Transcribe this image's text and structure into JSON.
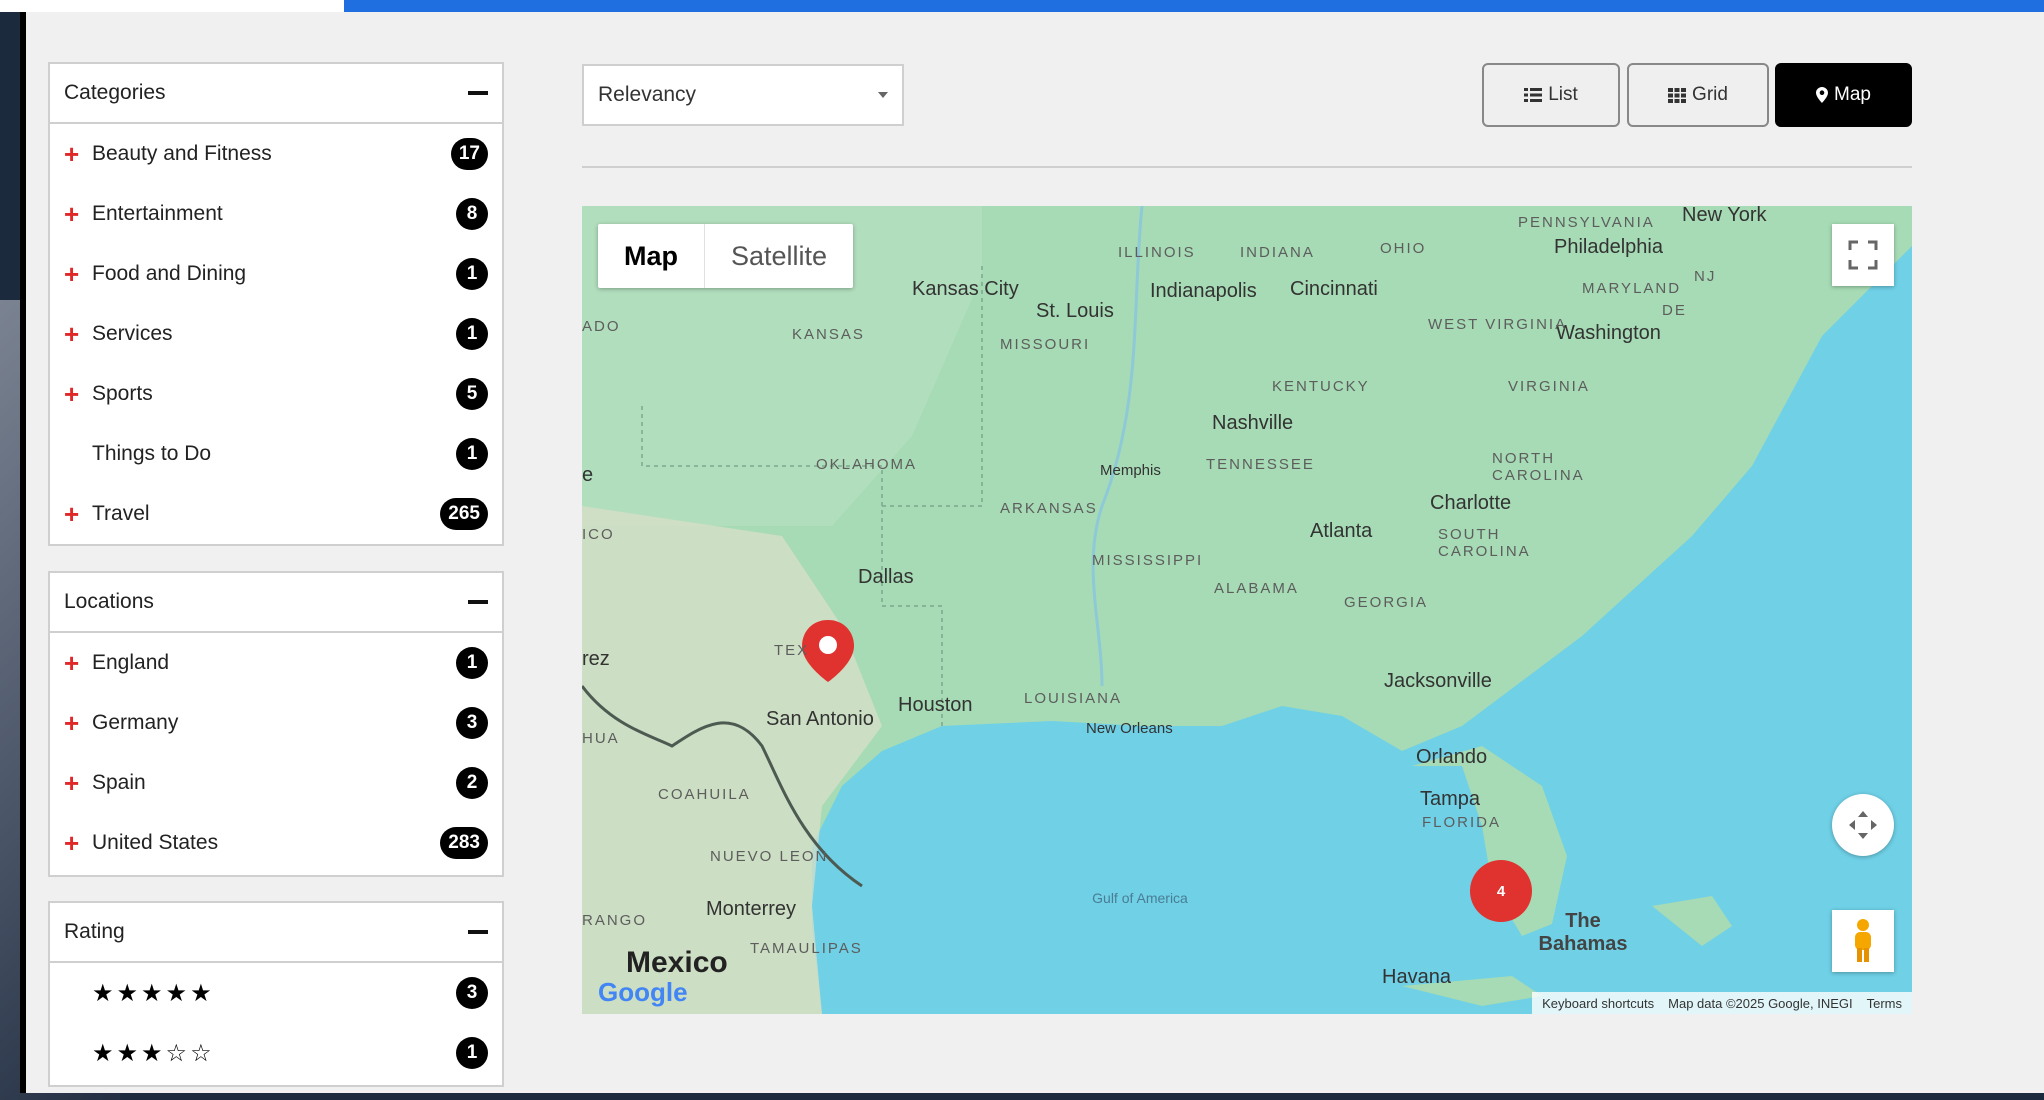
{
  "sidebar": {
    "categories": {
      "title": "Categories",
      "items": [
        {
          "label": "Beauty and Fitness",
          "count": "17",
          "expandable": true
        },
        {
          "label": "Entertainment",
          "count": "8",
          "expandable": true
        },
        {
          "label": "Food and Dining",
          "count": "1",
          "expandable": true
        },
        {
          "label": "Services",
          "count": "1",
          "expandable": true
        },
        {
          "label": "Sports",
          "count": "5",
          "expandable": true
        },
        {
          "label": "Things to Do",
          "count": "1",
          "expandable": false
        },
        {
          "label": "Travel",
          "count": "265",
          "expandable": true
        }
      ]
    },
    "locations": {
      "title": "Locations",
      "items": [
        {
          "label": "England",
          "count": "1"
        },
        {
          "label": "Germany",
          "count": "3"
        },
        {
          "label": "Spain",
          "count": "2"
        },
        {
          "label": "United States",
          "count": "283"
        }
      ]
    },
    "rating": {
      "title": "Rating",
      "items": [
        {
          "stars": "★★★★★",
          "count": "3"
        },
        {
          "stars": "★★★☆☆",
          "count": "1"
        }
      ]
    }
  },
  "toolbar": {
    "sort_value": "Relevancy",
    "list_label": "List",
    "grid_label": "Grid",
    "map_label": "Map"
  },
  "map": {
    "type_map": "Map",
    "type_satellite": "Satellite",
    "cluster_count": "4",
    "google": "Google",
    "footer": {
      "shortcuts": "Keyboard shortcuts",
      "data": "Map data ©2025 Google, INEGI",
      "terms": "Terms"
    },
    "labels": {
      "new_york": "New York",
      "pennsylvania": "PENNSYLVANIA",
      "philadelphia": "Philadelphia",
      "nj": "NJ",
      "maryland": "MARYLAND",
      "de": "DE",
      "washington": "Washington",
      "west_virginia": "WEST VIRGINIA",
      "virginia": "VIRGINIA",
      "illinois": "ILLINOIS",
      "indiana": "INDIANA",
      "ohio": "OHIO",
      "indianapolis": "Indianapolis",
      "cincinnati": "Cincinnati",
      "kansas_city": "Kansas City",
      "st_louis": "St. Louis",
      "kansas": "KANSAS",
      "missouri": "MISSOURI",
      "ado": "ADO",
      "kentucky": "KENTUCKY",
      "nashville": "Nashville",
      "tennessee": "TENNESSEE",
      "memphis": "Memphis",
      "north_carolina": "NORTH CAROLINA",
      "charlotte": "Charlotte",
      "oklahoma": "OKLAHOMA",
      "arkansas": "ARKANSAS",
      "atlanta": "Atlanta",
      "south_carolina": "SOUTH CAROLINA",
      "mississippi": "MISSISSIPPI",
      "alabama": "ALABAMA",
      "georgia": "GEORGIA",
      "dallas": "Dallas",
      "ico": "ICO",
      "e": "e",
      "rez": "rez",
      "tex": "TEX",
      "jacksonville": "Jacksonville",
      "houston": "Houston",
      "louisiana": "LOUISIANA",
      "san_antonio": "San Antonio",
      "new_orleans": "New Orleans",
      "hua": "HUA",
      "orlando": "Orlando",
      "tampa": "Tampa",
      "florida": "FLORIDA",
      "coahuila": "COAHUILA",
      "nuevo_leon": "NUEVO LEON",
      "gulf": "Gulf of America",
      "monterrey": "Monterrey",
      "rango": "RANGO",
      "the_bahamas": "The Bahamas",
      "tamaulipas": "TAMAULIPAS",
      "mexico": "Mexico",
      "havana": "Havana"
    }
  },
  "colors": {
    "accent_red": "#e02828",
    "water": "#6fd0e6",
    "land": "#a6dbb5",
    "top_blue": "#1f6fe0"
  }
}
